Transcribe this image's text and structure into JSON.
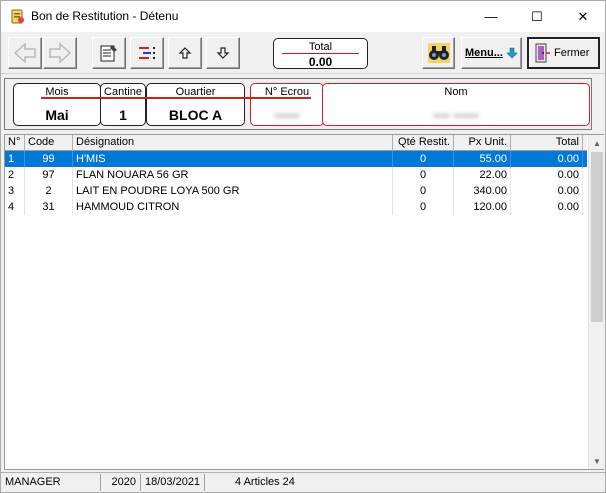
{
  "window": {
    "title": "Bon de Restitution - Détenu",
    "minimize": "—",
    "maximize": "☐",
    "close": "✕"
  },
  "toolbar": {
    "total_label": "Total",
    "total_value": "0.00",
    "menu_label": "Menu...",
    "fermer_label": "Fermer"
  },
  "info": {
    "mois_label": "Mois",
    "mois_value": "Mai",
    "cantine_label": "Cantine",
    "cantine_value": "1",
    "quartier_label": "Ouartier",
    "quartier_value": "BLOC A",
    "ecrou_label": "N° Ecrou",
    "ecrou_value": "••••••",
    "nom_label": "Nom",
    "nom_value": "•••• ••••••"
  },
  "grid": {
    "headers": {
      "no": "N°",
      "code": "Code",
      "designation": "Désignation",
      "qte": "Qté Restit.",
      "px": "Px Unit.",
      "total": "Total"
    },
    "rows": [
      {
        "no": "1",
        "code": "99",
        "designation": "H'MIS",
        "qte": "0",
        "px": "55.00",
        "total": "0.00"
      },
      {
        "no": "2",
        "code": "97",
        "designation": "FLAN NOUARA 56 GR",
        "qte": "0",
        "px": "22.00",
        "total": "0.00"
      },
      {
        "no": "3",
        "code": "2",
        "designation": "LAIT EN POUDRE LOYA 500 GR",
        "qte": "0",
        "px": "340.00",
        "total": "0.00"
      },
      {
        "no": "4",
        "code": "31",
        "designation": "HAMMOUD CITRON",
        "qte": "0",
        "px": "120.00",
        "total": "0.00"
      }
    ],
    "selected_row": 0
  },
  "statusbar": {
    "user": "MANAGER",
    "year": "2020",
    "date": "18/03/2021",
    "articles": "4 Articles  24"
  },
  "colors": {
    "selection": "#0078d7",
    "accent_red": "#d02020"
  }
}
